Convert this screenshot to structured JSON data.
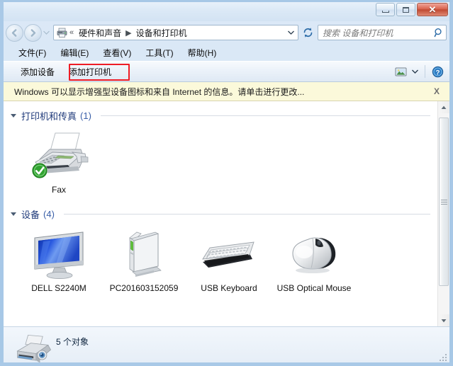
{
  "window": {
    "controls": {
      "minimize_label": "最小化",
      "maximize_label": "最大化",
      "close_label": "✕"
    }
  },
  "addressbar": {
    "back_label": "后退",
    "forward_label": "前进",
    "recent_dropdown_label": "最近浏览的位置",
    "breadcrumb_chevrons": "«",
    "breadcrumb": [
      {
        "label": "硬件和声音"
      },
      {
        "label": "设备和打印机"
      }
    ],
    "separator": "▶",
    "refresh_label": "刷新",
    "search": {
      "placeholder": "搜索 设备和打印机",
      "value": ""
    }
  },
  "menubar": {
    "items": [
      {
        "label": "文件(F)"
      },
      {
        "label": "编辑(E)"
      },
      {
        "label": "查看(V)"
      },
      {
        "label": "工具(T)"
      },
      {
        "label": "帮助(H)"
      }
    ]
  },
  "toolbar": {
    "add_device_label": "添加设备",
    "add_printer_label": "添加打印机",
    "view_icon": "preview-pane-icon",
    "view_caret": "▼",
    "help_label": "?"
  },
  "annotation": {
    "target": "添加打印机",
    "color": "#ee1c25"
  },
  "infobar": {
    "message": "Windows 可以显示增强型设备图标和来自 Internet 的信息。请单击进行更改...",
    "close_label": "X",
    "background": "#fbf9da"
  },
  "groups": [
    {
      "title": "打印机和传真",
      "count": "(1)",
      "items": [
        {
          "name": "Fax",
          "icon": "fax-machine-icon",
          "default": true
        }
      ]
    },
    {
      "title": "设备",
      "count": "(4)",
      "items": [
        {
          "name": "DELL S2240M",
          "icon": "monitor-icon",
          "default": false
        },
        {
          "name": "PC201603152059",
          "icon": "computer-tower-icon",
          "default": false
        },
        {
          "name": "USB Keyboard",
          "icon": "keyboard-icon",
          "default": false
        },
        {
          "name": "USB Optical Mouse",
          "icon": "mouse-icon",
          "default": false
        }
      ]
    }
  ],
  "statusbar": {
    "icon": "printer-device-icon",
    "text": "5 个对象"
  },
  "colors": {
    "group_title": "#1f3a7a",
    "frame": "#a0c3e4",
    "close_button": "#c04a33",
    "default_badge_green": "#2f9b2f"
  }
}
